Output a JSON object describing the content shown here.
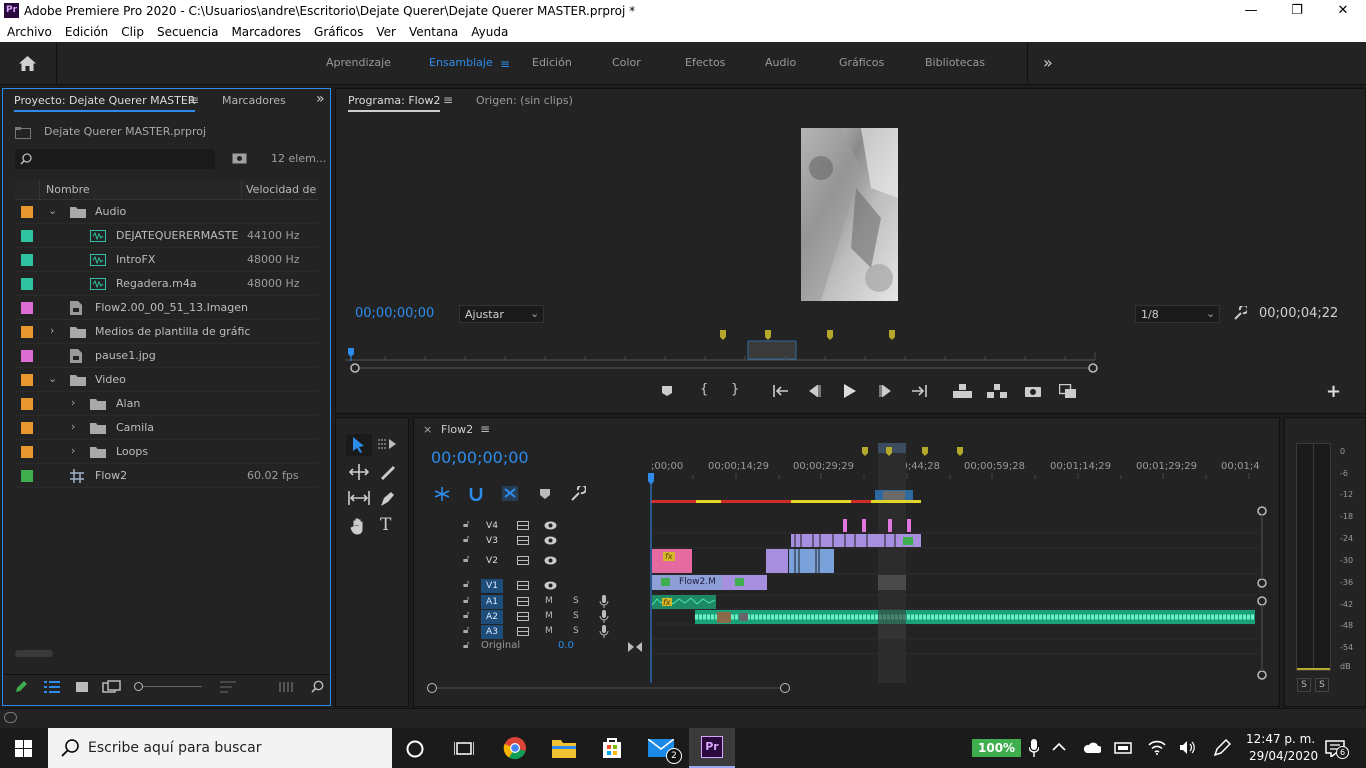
{
  "titlebar": {
    "logo": "Pr",
    "title": "Adobe Premiere Pro 2020 - C:\\Usuarios\\andre\\Escritorio\\Dejate Querer\\Dejate Querer MASTER.prproj *",
    "minimize": "—",
    "maximize": "❐",
    "close": "✕"
  },
  "menu": [
    "Archivo",
    "Edición",
    "Clip",
    "Secuencia",
    "Marcadores",
    "Gráficos",
    "Ver",
    "Ventana",
    "Ayuda"
  ],
  "workspaces": {
    "items": [
      "Aprendizaje",
      "Ensamblaje",
      "Edición",
      "Color",
      "Efectos",
      "Audio",
      "Gráficos",
      "Bibliotecas"
    ],
    "active": "Ensamblaje",
    "more": "»"
  },
  "project": {
    "tab": "Proyecto: Dejate Querer MASTER",
    "tab2": "Marcadores",
    "file": "Dejate Querer MASTER.prproj",
    "count": "12 elem...",
    "col_name": "Nombre",
    "col_rate": "Velocidad de fo",
    "items": [
      {
        "name": "Audio",
        "value": "",
        "color": "#e8962e"
      },
      {
        "name": "DEJATEQUERERMASTE",
        "value": "44100 Hz",
        "color": "#2ec2a0"
      },
      {
        "name": "IntroFX",
        "value": "48000 Hz",
        "color": "#2ec2a0"
      },
      {
        "name": "Regadera.m4a",
        "value": "48000 Hz",
        "color": "#2ec2a0"
      },
      {
        "name": "Flow2.00_00_51_13.Imagen",
        "value": "",
        "color": "#dd6ed1"
      },
      {
        "name": "Medios de plantilla de gráfic",
        "value": "",
        "color": "#e8962e"
      },
      {
        "name": "pause1.jpg",
        "value": "",
        "color": "#dd6ed1"
      },
      {
        "name": "Video",
        "value": "",
        "color": "#e8962e"
      },
      {
        "name": "Alan",
        "value": "",
        "color": "#e8962e"
      },
      {
        "name": "Camila",
        "value": "",
        "color": "#e8962e"
      },
      {
        "name": "Loops",
        "value": "",
        "color": "#e8962e"
      },
      {
        "name": "Flow2",
        "value": "60.02 fps",
        "color": "#3fae4f"
      }
    ]
  },
  "program": {
    "tab": "Programa: Flow2",
    "tab2": "Origen: (sin clips)",
    "timecode": "00;00;00;00",
    "fit": "Ajustar",
    "resolution": "1/8",
    "duration": "00;00;04;22"
  },
  "timeline": {
    "tab": "Flow2",
    "timecode": "00;00;00;00",
    "ruler": [
      ";00;00",
      "00;00;14;29",
      "00;00;29;29",
      "00;00;44;28",
      "00;00;59;28",
      "00;01;14;29",
      "00;01;29;29",
      "00;01;4"
    ],
    "tracks": {
      "v4": "V4",
      "v3": "V3",
      "v2": "V2",
      "v1": "V1",
      "v1src": "V1",
      "a1": "A1",
      "a1src": "A1",
      "a2": "A2",
      "a3": "A3",
      "m": "M",
      "s": "S",
      "original": "Original",
      "original_value": "0.0"
    },
    "clip_v1": "Flow2.M",
    "fx": "fx"
  },
  "meter": {
    "labels": [
      "0",
      "-6",
      "-12",
      "-18",
      "-24",
      "-30",
      "-36",
      "-42",
      "-48",
      "-54",
      "dB"
    ],
    "s1": "S",
    "s2": "S"
  },
  "taskbar": {
    "search": "Escribe aquí para buscar",
    "battery": "100%",
    "time": "12:47 p. m.",
    "date": "29/04/2020",
    "notif": "6",
    "mail_badge": "2",
    "pr": "Pr"
  },
  "colors": {
    "accent": "#2d8ceb",
    "audio": "#2ec2a0",
    "video": "#9f8fd9",
    "pink": "#e66aa0"
  }
}
